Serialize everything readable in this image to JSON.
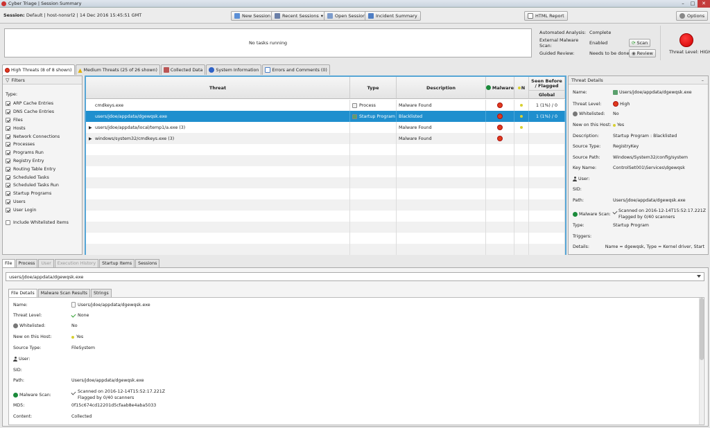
{
  "window": {
    "title": "Cyber Triage | Session Summary"
  },
  "session": {
    "label": "Session:",
    "value": "Default | host-nonsrl2 | 14 Dec 2016 15:45:51 GMT"
  },
  "toolbar": {
    "new_session": "New Session",
    "recent_sessions": "Recent Sessions",
    "open_session": "Open Session",
    "incident_summary": "Incident Summary",
    "html_report": "HTML Report",
    "options": "Options"
  },
  "status": {
    "text": "No tasks running"
  },
  "analysis": {
    "automated_label": "Automated Analysis:",
    "automated_value": "Complete",
    "external_label": "External Malware Scan:",
    "external_value": "Enabled",
    "guided_label": "Guided Review:",
    "guided_value": "Needs to be done",
    "scan_button": "Scan",
    "review_button": "Review"
  },
  "threat_level": {
    "label": "Threat Level: HIGH",
    "color": "#e00000"
  },
  "tabs": [
    {
      "label": "High Threats (8 of 8 shown)",
      "icon": "high-threat-icon"
    },
    {
      "label": "Medium Threats (25 of 26 shown)",
      "icon": "warning-icon"
    },
    {
      "label": "Collected Data",
      "icon": "data-icon"
    },
    {
      "label": "System Information",
      "icon": "info-icon"
    },
    {
      "label": "Errors and Comments (0)",
      "icon": "comment-icon"
    }
  ],
  "filters": {
    "title": "Filters",
    "type_label": "Type:",
    "items": [
      "ARP Cache Entries",
      "DNS Cache Entries",
      "Files",
      "Hosts",
      "Network Connections",
      "Processes",
      "Programs Run",
      "Registry Entry",
      "Routing Table Entry",
      "Scheduled Tasks",
      "Scheduled Tasks Run",
      "Startup Programs",
      "Users",
      "User Login"
    ],
    "include_whitelisted": "Include Whitelisted items"
  },
  "table": {
    "headers": {
      "threat": "Threat",
      "type": "Type",
      "description": "Description",
      "malware": "Malware",
      "n": "N",
      "seen": "Seen Before / Flagged",
      "global": "Global"
    },
    "rows": [
      {
        "threat": "cmdkeys.exe",
        "type": "Process",
        "description": "Malware Found",
        "malware": true,
        "new": true,
        "seen": "1 (1%) / 0",
        "expand": false
      },
      {
        "threat": "users/jdoe/appdata/dgewqsk.exe",
        "type": "Startup Program",
        "description": "Blacklisted",
        "malware": true,
        "new": true,
        "seen": "1 (1%) / 0",
        "expand": false
      },
      {
        "threat": "users/jdoe/appdata/local/temp1/a.exe (3)",
        "type": "",
        "description": "Malware Found",
        "malware": true,
        "new": true,
        "seen": "",
        "expand": true
      },
      {
        "threat": "windows/system32/cmdkeys.exe (3)",
        "type": "",
        "description": "Malware Found",
        "malware": true,
        "new": false,
        "seen": "",
        "expand": true
      }
    ]
  },
  "threat_details": {
    "title": "Threat Details",
    "name_label": "Name:",
    "name_value": "Users/jdoe/appdata/dgewqsk.exe",
    "level_label": "Threat Level:",
    "level_value": "High",
    "whitelisted_label": "Whitelisted:",
    "whitelisted_value": "No",
    "new_label": "New on this Host:",
    "new_value": "Yes",
    "desc_label": "Description:",
    "desc_value": "Startup Program : Blacklisted",
    "srctype_label": "Source Type:",
    "srctype_value": "RegistryKey",
    "srcpath_label": "Source Path:",
    "srcpath_value": "Windows/System32/config/system",
    "keyname_label": "Key Name:",
    "keyname_value": "ControlSet001\\Services\\dgewqsk",
    "user_label": "User:",
    "user_value": "",
    "sid_label": "SID:",
    "sid_value": "",
    "path_label": "Path:",
    "path_value": "Users/jdoe/appdata/dgewqsk.exe",
    "scan_label": "Malware Scan:",
    "scan_value1": "Scanned on 2016-12-14T15:52:17.221Z",
    "scan_value2": "Flagged by 0/40 scanners",
    "type_label": "Type:",
    "type_value": "Startup Program",
    "triggers_label": "Triggers:",
    "triggers_value": "",
    "details_label": "Details:",
    "details_value": "Name = dgewqsk, Type = Kernel driver, Start"
  },
  "bottom_tabs": [
    "File",
    "Process",
    "User",
    "Execution History",
    "Startup Items",
    "Sessions"
  ],
  "file_combo": "users/jdoe/appdata/dgewqsk.exe",
  "sub_tabs": [
    "File Details",
    "Malware Scan Results",
    "Strings"
  ],
  "file_details": {
    "name_label": "Name:",
    "name_value": "Users/jdoe/appdata/dgewqsk.exe",
    "level_label": "Threat Level:",
    "level_value": "None",
    "whitelisted_label": "Whitelisted:",
    "whitelisted_value": "No",
    "new_label": "New on this Host:",
    "new_value": "Yes",
    "srctype_label": "Source Type:",
    "srctype_value": "FileSystem",
    "user_label": "User:",
    "user_value": "",
    "sid_label": "SID:",
    "sid_value": "",
    "path_label": "Path:",
    "path_value": "Users/jdoe/appdata/dgewqsk.exe",
    "scan_label": "Malware Scan:",
    "scan_value1": "Scanned on 2016-12-14T15:52:17.221Z",
    "scan_value2": "Flagged by 0/40 scanners",
    "md5_label": "MD5:",
    "md5_value": "0f15c674cd12201d5cfaab8e4aba5033",
    "content_label": "Content:",
    "content_value": "Collected"
  }
}
